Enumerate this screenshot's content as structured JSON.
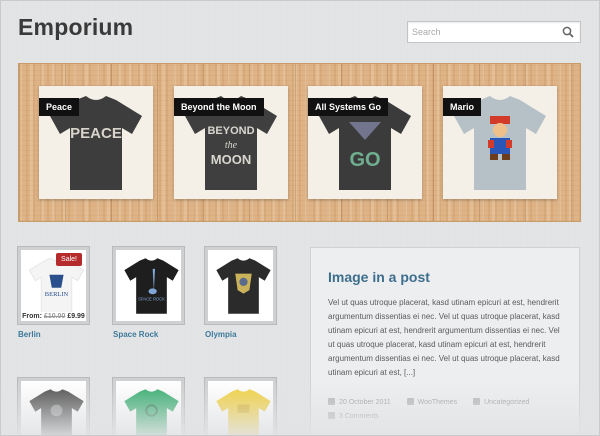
{
  "site": {
    "title": "Emporium"
  },
  "search": {
    "placeholder": "Search"
  },
  "featured": [
    {
      "label": "Peace",
      "shirt_color": "#3d3d3d",
      "print_text": "PEACE"
    },
    {
      "label": "Beyond the Moon",
      "shirt_color": "#3f3f3f",
      "print_lines": [
        "BEYOND",
        "the",
        "MOON"
      ]
    },
    {
      "label": "All Systems Go",
      "shirt_color": "#3b3b3b",
      "print_text": "GO"
    },
    {
      "label": "Mario",
      "shirt_color": "#b6c1c7"
    }
  ],
  "products": [
    {
      "name": "Berlin",
      "shirt_color": "#ffffff",
      "sale_badge": "Sale!",
      "price_prefix": "From:",
      "price_old": "£10.00",
      "price_new": "£9.99",
      "print_text": "BERLIN"
    },
    {
      "name": "Space Rock",
      "shirt_color": "#1e1e1e"
    },
    {
      "name": "Olympia",
      "shirt_color": "#2b2b2b"
    },
    {
      "name": "",
      "shirt_color": "#4a4a4a"
    },
    {
      "name": "",
      "shirt_color": "#2faa6a"
    },
    {
      "name": "",
      "shirt_color": "#f2d03a"
    }
  ],
  "post": {
    "title": "Image in a post",
    "body": "Vel ut quas utroque placerat, kasd utinam epicuri at est, hendrerit argumentum dissentias ei nec. Vel ut quas utroque placerat, kasd utinam epicuri at est, hendrerit argumentum dissentias ei nec. Vel ut quas utroque placerat, kasd utinam epicuri at est, hendrerit argumentum dissentias ei nec. Vel ut quas utroque placerat, kasd utinam epicuri at est, [...]",
    "date": "20 October 2011",
    "author": "WooThemes",
    "category": "Uncategorized",
    "comments": "3 Comments"
  },
  "colors": {
    "link": "#3d7a9a",
    "sale": "#b52b2b",
    "heading": "#3d6e8c"
  }
}
